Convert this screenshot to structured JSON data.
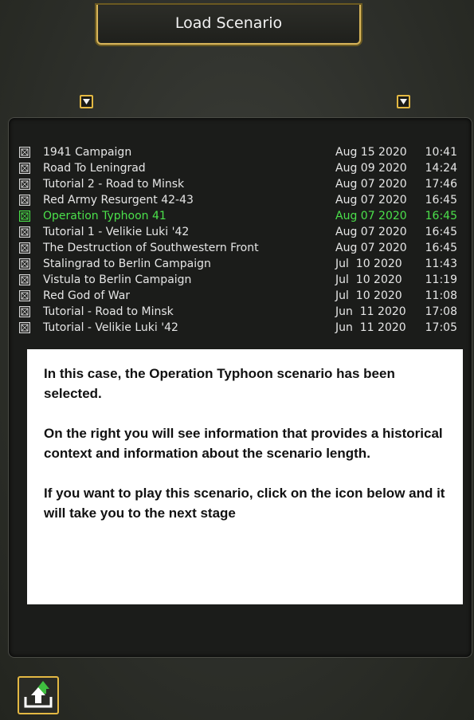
{
  "header": {
    "title": "Load Scenario"
  },
  "sort_buttons": {
    "left_icon": "triangle-down-icon",
    "right_icon": "triangle-down-icon"
  },
  "scenarios": [
    {
      "name": "1941 Campaign",
      "date": "Aug 15 2020",
      "time": "10:41",
      "selected": false
    },
    {
      "name": "Road To Leningrad",
      "date": "Aug 09 2020",
      "time": "14:24",
      "selected": false
    },
    {
      "name": "Tutorial 2 - Road to Minsk",
      "date": "Aug 07 2020",
      "time": "17:46",
      "selected": false
    },
    {
      "name": "Red Army Resurgent 42-43",
      "date": "Aug 07 2020",
      "time": "16:45",
      "selected": false
    },
    {
      "name": "Operation Typhoon 41",
      "date": "Aug 07 2020",
      "time": "16:45",
      "selected": true
    },
    {
      "name": "Tutorial 1 - Velikie Luki '42",
      "date": "Aug 07 2020",
      "time": "16:45",
      "selected": false
    },
    {
      "name": "The Destruction of Southwestern Front",
      "date": "Aug 07 2020",
      "time": "16:45",
      "selected": false
    },
    {
      "name": "Stalingrad to Berlin Campaign",
      "date": "Jul  10 2020",
      "time": "11:43",
      "selected": false
    },
    {
      "name": "Vistula to Berlin Campaign",
      "date": "Jul  10 2020",
      "time": "11:19",
      "selected": false
    },
    {
      "name": "Red God of War",
      "date": "Jul  10 2020",
      "time": "11:08",
      "selected": false
    },
    {
      "name": "Tutorial - Road to Minsk",
      "date": "Jun  11 2020",
      "time": "17:08",
      "selected": false
    },
    {
      "name": "Tutorial - Velikie Luki '42",
      "date": "Jun  11 2020",
      "time": "17:05",
      "selected": false
    }
  ],
  "note": {
    "p1": "In this case, the Operation Typhoon scenario has been selected.",
    "p2": "On the right you will see information that provides a historical context and information about the scenario length.",
    "p3": "If you want to play this scenario, click on the icon below and it will take you to the next stage"
  },
  "load_button": {
    "icon": "upload-arrow-icon"
  },
  "colors": {
    "accent": "#e3b843",
    "selected_text": "#4be04b",
    "text": "#e6e6e6"
  }
}
